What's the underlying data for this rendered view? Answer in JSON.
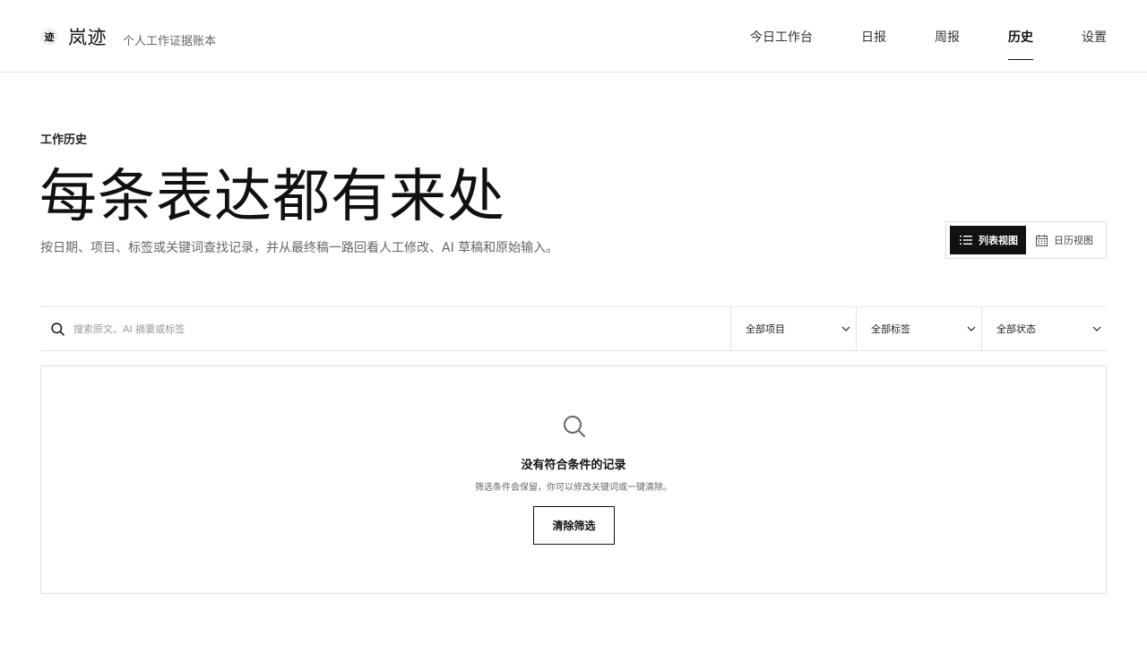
{
  "brand": {
    "logo_text": "迹",
    "name": "岚迹",
    "tagline": "个人工作证据账本"
  },
  "nav": {
    "items": [
      {
        "label": "今日工作台",
        "active": false
      },
      {
        "label": "日报",
        "active": false
      },
      {
        "label": "周报",
        "active": false
      },
      {
        "label": "历史",
        "active": true
      },
      {
        "label": "设置",
        "active": false
      }
    ]
  },
  "hero": {
    "eyebrow": "工作历史",
    "title": "每条表达都有来处",
    "subtitle": "按日期、项目、标签或关键词查找记录，并从最终稿一路回看人工修改、AI 草稿和原始输入。"
  },
  "view_toggle": {
    "list_label": "列表视图",
    "calendar_label": "日历视图",
    "active": "list"
  },
  "filters": {
    "search_placeholder": "搜索原文、AI 摘要或标签",
    "search_value": "",
    "project": "全部项目",
    "tag": "全部标签",
    "status": "全部状态"
  },
  "empty_state": {
    "title": "没有符合条件的记录",
    "description": "筛选条件会保留，你可以修改关键词或一键清除。",
    "clear_button": "清除筛选"
  },
  "icons": {
    "search": "search-icon",
    "list": "list-icon",
    "calendar": "calendar-icon",
    "chevron": "chevron-down-icon"
  },
  "colors": {
    "text": "#111111",
    "muted": "#666666",
    "border": "#dddddd",
    "accent": "#111111"
  }
}
